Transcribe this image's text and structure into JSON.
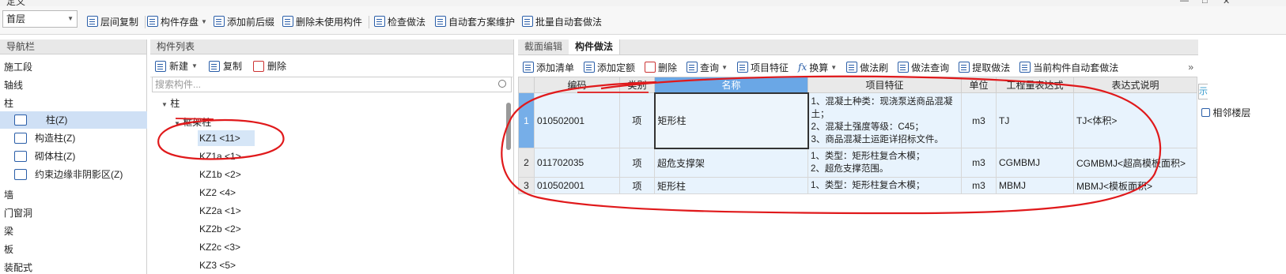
{
  "window": {
    "title": "定义"
  },
  "toolbar": {
    "floor_value": "首层",
    "buttons": [
      "层间复制",
      "构件存盘",
      "添加前后缀",
      "删除未使用构件",
      "检查做法",
      "自动套方案维护",
      "批量自动套做法"
    ]
  },
  "nav": {
    "header": "导航栏",
    "items": [
      "施工段",
      "轴线",
      "柱",
      "墙",
      "门窗洞",
      "梁",
      "板",
      "装配式"
    ],
    "sub_items": [
      "柱(Z)",
      "构造柱(Z)",
      "砌体柱(Z)",
      "约束边缘非阴影区(Z)"
    ]
  },
  "component_list": {
    "header": "构件列表",
    "tools": [
      "新建",
      "复制",
      "删除"
    ],
    "search_placeholder": "搜索构件...",
    "tree_root": "柱",
    "tree_group": "框架柱",
    "items": [
      "KZ1 <11>",
      "KZ1a <1>",
      "KZ1b <2>",
      "KZ2 <4>",
      "KZ2a <1>",
      "KZ2b <2>",
      "KZ2c <3>",
      "KZ3 <5>"
    ]
  },
  "method_panel": {
    "tabs": [
      "截面编辑",
      "构件做法"
    ],
    "tools": [
      "添加清单",
      "添加定额",
      "删除",
      "查询",
      "项目特征",
      "换算",
      "做法刷",
      "做法查询",
      "提取做法",
      "当前构件自动套做法"
    ],
    "columns": [
      "编码",
      "类别",
      "名称",
      "项目特征",
      "单位",
      "工程量表达式",
      "表达式说明"
    ],
    "rows": [
      {
        "no": "1",
        "code": "010502001",
        "type": "项",
        "name": "矩形柱",
        "feature": [
          "1、混凝土种类：现浇泵送商品混凝土；",
          "2、混凝土强度等级：C45；",
          "3、商品混凝土运距详招标文件。"
        ],
        "unit": "m3",
        "expr": "TJ",
        "desc": "TJ<体积>"
      },
      {
        "no": "2",
        "code": "011702035",
        "type": "项",
        "name": "超危支撑架",
        "feature": [
          "1、类型：矩形柱复合木模；",
          "2、超危支撑范围。"
        ],
        "unit": "m3",
        "expr": "CGMBMJ",
        "desc": "CGMBMJ<超高模板面积>"
      },
      {
        "no": "3",
        "code": "010502001",
        "type": "项",
        "name": "矩形柱",
        "feature": [
          "1、类型：矩形柱复合木模；"
        ],
        "unit": "m3",
        "expr": "MBMJ",
        "desc": "MBMJ<模板面积>"
      }
    ]
  },
  "side": {
    "tab_label": "示",
    "neighbor": "相邻楼层"
  },
  "colors": {
    "selected_header": "#6aa7e6",
    "row_bg": "#e8f3fd",
    "annotation": "#e0191b"
  }
}
